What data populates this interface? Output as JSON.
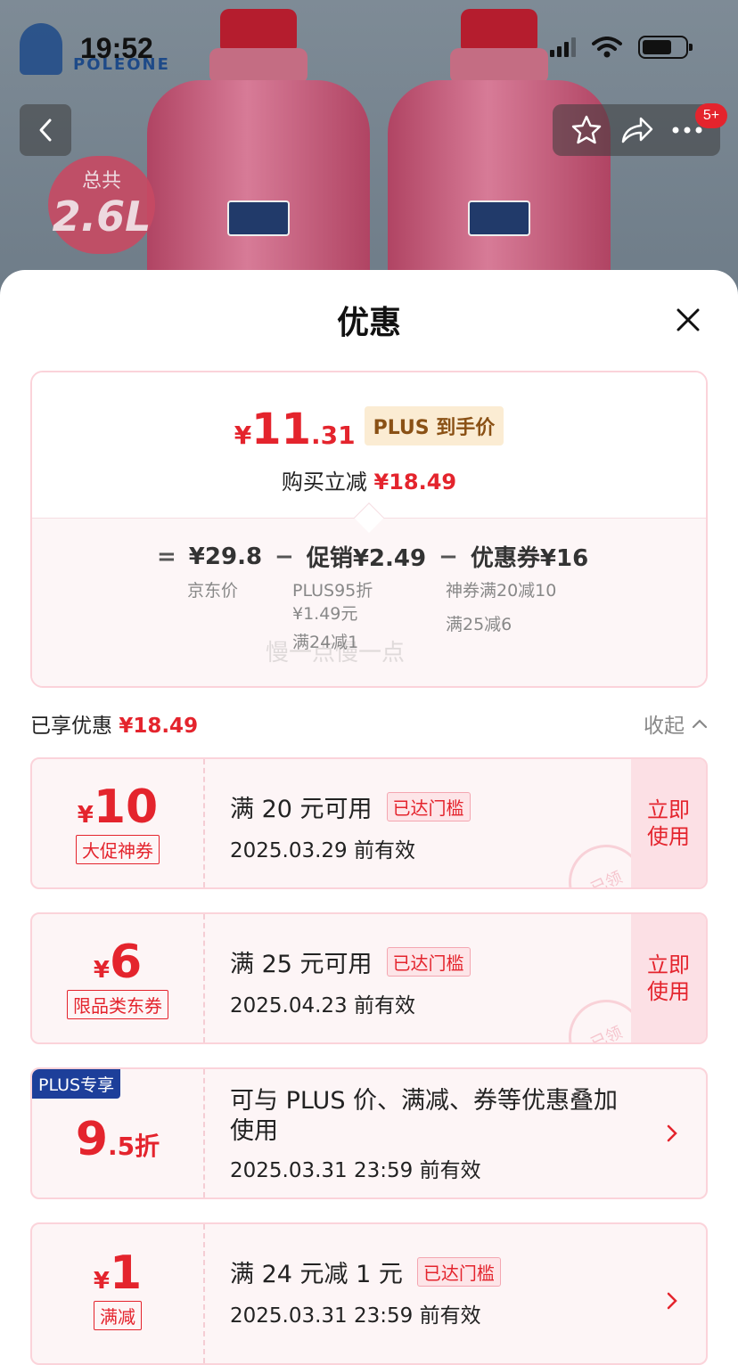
{
  "status_bar": {
    "time": "19:52"
  },
  "background": {
    "logo_text": "POLEONE",
    "badge_line1": "总共",
    "badge_line2": "2.6L"
  },
  "header": {
    "notification_count": "5+"
  },
  "sheet": {
    "title": "优惠"
  },
  "summary": {
    "currency": "¥",
    "final_int": "11",
    "final_dec": ".31",
    "plus_tag": "PLUS 到手价",
    "reduce_label": "购买立减",
    "reduce_amount": "¥18.49",
    "equals": "=",
    "jd_price": "¥29.8",
    "minus1": "−",
    "promo": "促销¥2.49",
    "minus2": "−",
    "coupon_total": "优惠券¥16",
    "jd_price_label": "京东价",
    "promo_detail1": "PLUS95折",
    "promo_detail2": "¥1.49元",
    "promo_detail3": "满24减1",
    "coupon_detail1": "神券满20减10",
    "coupon_detail2": "满25减6",
    "watermark": "慢一点慢一点"
  },
  "enjoyed": {
    "label": "已享优惠",
    "amount": "¥18.49",
    "collapse_label": "收起"
  },
  "coupons": [
    {
      "currency": "¥",
      "amount": "10",
      "tag": "大促神券",
      "condition": "满 20 元可用",
      "reached": "已达门槛",
      "valid": "2025.03.29 前有效",
      "use_label_1": "立即",
      "use_label_2": "使用",
      "stamp": "已领"
    },
    {
      "currency": "¥",
      "amount": "6",
      "tag": "限品类东券",
      "condition": "满 25 元可用",
      "reached": "已达门槛",
      "valid": "2025.04.23 前有效",
      "use_label_1": "立即",
      "use_label_2": "使用",
      "stamp": "已领"
    },
    {
      "exclusive": "PLUS专享",
      "discount_int": "9",
      "discount_dec": ".5折",
      "desc_line1": "可与 PLUS 价、满减、券等优惠叠加",
      "desc_line2": "使用",
      "valid": "2025.03.31 23:59 前有效"
    },
    {
      "currency": "¥",
      "amount": "1",
      "tag": "满减",
      "condition": "满 24 元减 1 元",
      "reached": "已达门槛",
      "valid": "2025.03.31 23:59 前有效"
    }
  ],
  "colors": {
    "accent_red": "#e4242d",
    "plus_blue": "#1d3f9a",
    "coupon_bg": "#fdf5f6"
  }
}
